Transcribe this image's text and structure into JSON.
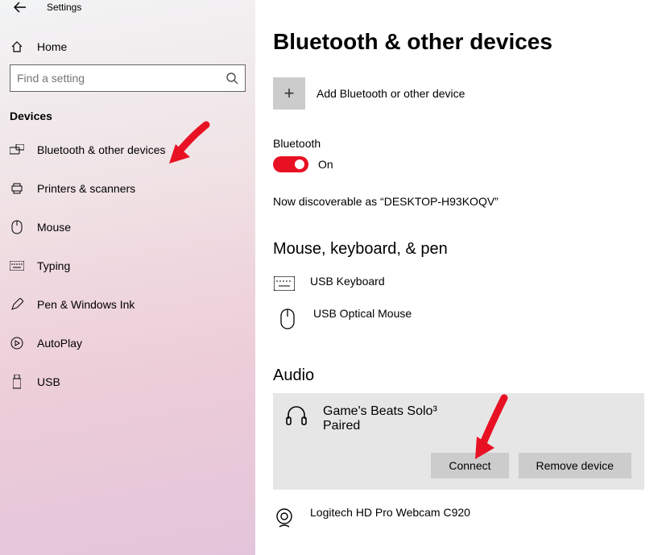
{
  "app_title": "Settings",
  "home_label": "Home",
  "search_placeholder": "Find a setting",
  "section_label": "Devices",
  "nav": [
    {
      "label": "Bluetooth & other devices"
    },
    {
      "label": "Printers & scanners"
    },
    {
      "label": "Mouse"
    },
    {
      "label": "Typing"
    },
    {
      "label": "Pen & Windows Ink"
    },
    {
      "label": "AutoPlay"
    },
    {
      "label": "USB"
    }
  ],
  "main": {
    "title": "Bluetooth & other devices",
    "add_label": "Add Bluetooth or other device",
    "bluetooth_label": "Bluetooth",
    "bluetooth_state": "On",
    "discoverable": "Now discoverable as “DESKTOP-H93KOQV”",
    "cat_mouse": "Mouse, keyboard, & pen",
    "dev_keyboard": "USB Keyboard",
    "dev_mouse": "USB Optical Mouse",
    "cat_audio": "Audio",
    "audio_device": "Game's Beats Solo³",
    "audio_status": "Paired",
    "btn_connect": "Connect",
    "btn_remove": "Remove device",
    "dev_webcam": "Logitech HD Pro Webcam C920"
  }
}
